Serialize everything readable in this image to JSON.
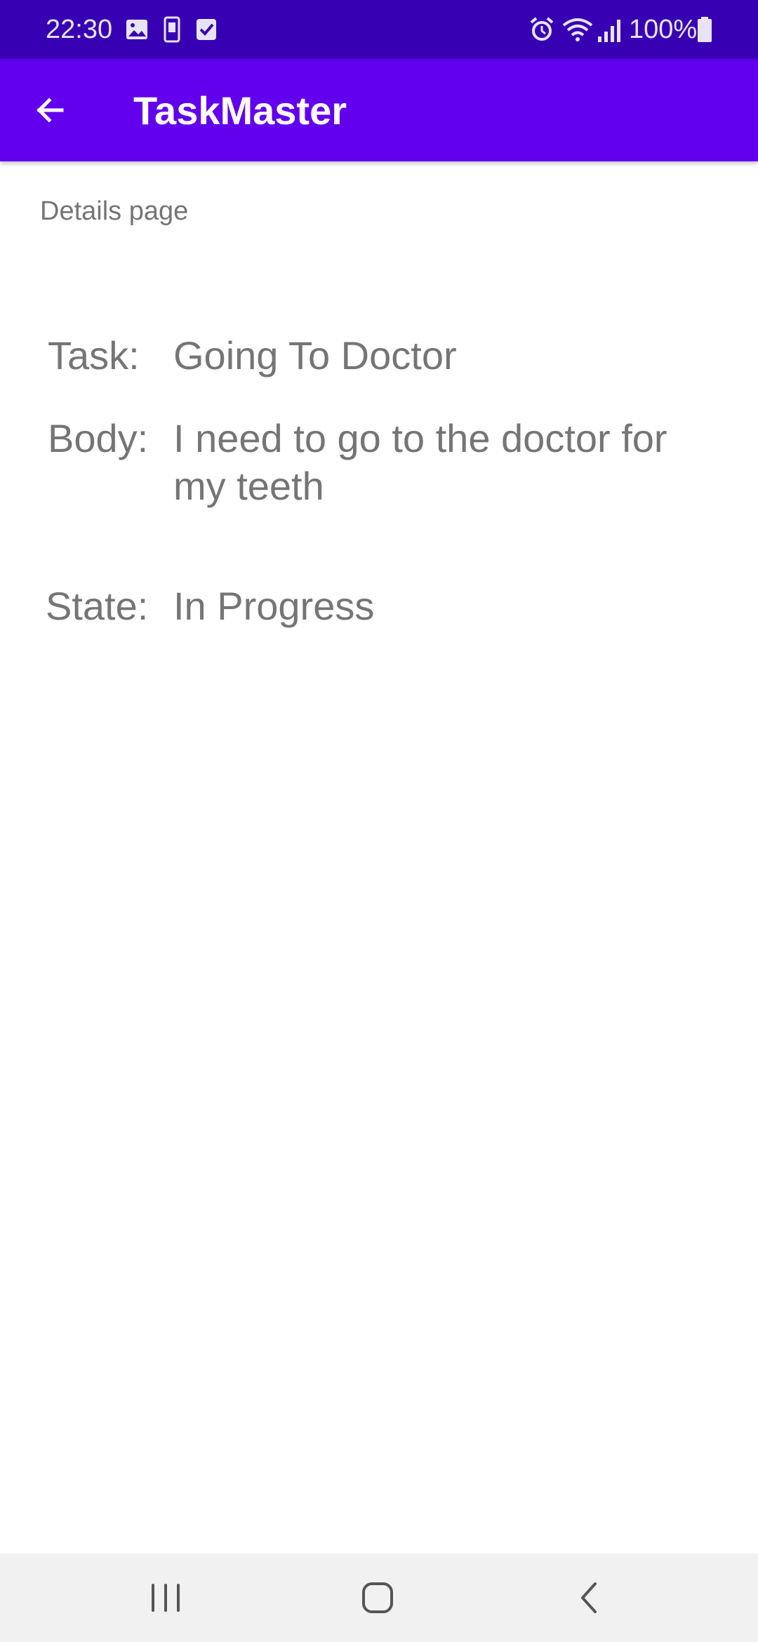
{
  "status_bar": {
    "time": "22:30",
    "battery": "100%",
    "left_icons": [
      "image-icon",
      "phone-icon",
      "checkbox-icon"
    ],
    "right_icons": [
      "alarm-icon",
      "wifi-icon",
      "signal-icon",
      "battery-icon"
    ]
  },
  "app_bar": {
    "title": "TaskMaster",
    "back_icon": "arrow-back-icon",
    "color": "#6200ee"
  },
  "content": {
    "page_label": "Details page",
    "task_label": "Task:",
    "task_value": "Going To Doctor",
    "body_label": "Body:",
    "body_value": "I need to go to the doctor for my teeth",
    "state_label": "State:",
    "state_value": "In Progress"
  },
  "nav_bar": {
    "buttons": [
      "recent-apps-icon",
      "home-icon",
      "back-icon"
    ]
  },
  "colors": {
    "status_bar": "#3700b3",
    "app_bar": "#6200ee",
    "text_secondary": "#757575"
  }
}
